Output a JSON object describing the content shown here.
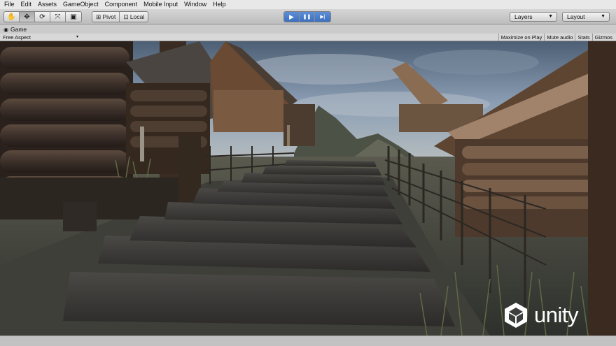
{
  "menu": [
    "File",
    "Edit",
    "Assets",
    "GameObject",
    "Component",
    "Mobile Input",
    "Window",
    "Help"
  ],
  "toolbar": {
    "tools": [
      {
        "name": "hand-tool",
        "icon": "hand-icon",
        "glyph": "✋"
      },
      {
        "name": "move-tool",
        "icon": "move-icon",
        "glyph": "✥"
      },
      {
        "name": "rotate-tool",
        "icon": "rotate-icon",
        "glyph": "⟳"
      },
      {
        "name": "scale-tool",
        "icon": "scale-icon",
        "glyph": "⤧"
      },
      {
        "name": "rect-tool",
        "icon": "rect-icon",
        "glyph": "▣"
      }
    ],
    "pivot_label": "Pivot",
    "local_label": "Local",
    "play_glyph": "▶",
    "pause_glyph": "❚❚",
    "step_glyph": "▶|",
    "layers_label": "Layers",
    "layout_label": "Layout"
  },
  "tab": {
    "title": "Game"
  },
  "gamebar": {
    "aspect": "Free Aspect",
    "options": [
      "Maximize on Play",
      "Mute audio",
      "Stats",
      "Gizmos"
    ]
  },
  "watermark": {
    "text": "unity"
  },
  "colors": {
    "accent": "#3c6fbe",
    "toolbar": "#c8c8c8",
    "sky": "#8aa0b8"
  }
}
